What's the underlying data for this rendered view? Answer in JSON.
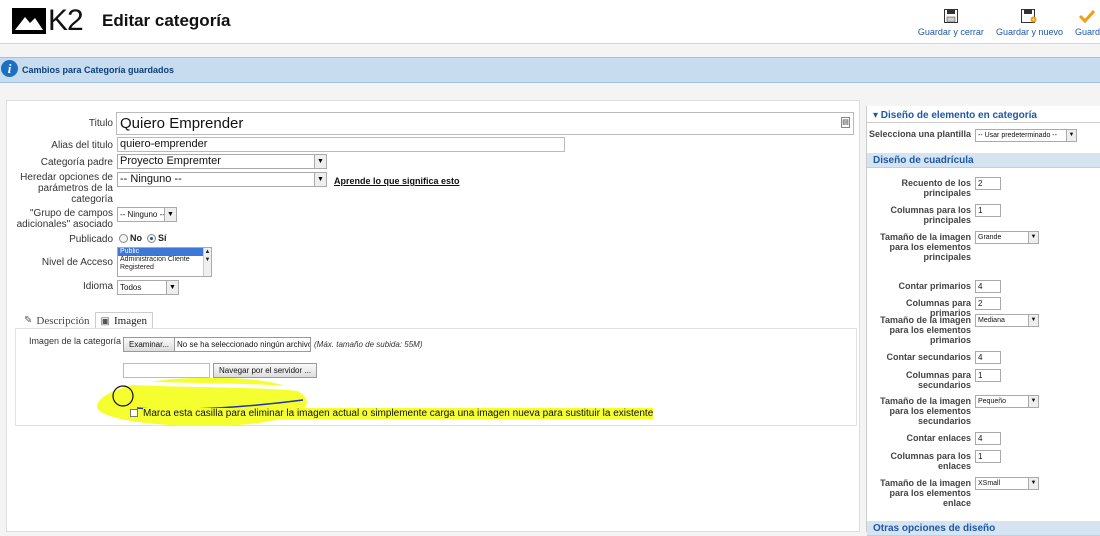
{
  "header": {
    "logo_text": "K2",
    "title": "Editar categoría",
    "buttons": [
      {
        "label": "Guardar y cerrar",
        "icon": "save-icon"
      },
      {
        "label": "Guardar y nuevo",
        "icon": "save-new-icon"
      },
      {
        "label": "Guard",
        "icon": "checkmark-icon"
      }
    ]
  },
  "message": "Cambios para Categoría guardados",
  "form": {
    "title_label": "Titulo",
    "title_value": "Quiero Emprender",
    "alias_label": "Alias del titulo",
    "alias_value": "quiero-emprender",
    "parent_label": "Categoría padre",
    "parent_value": "Proyecto Empremter",
    "inherit_label": "Heredar opciones de parámetros de la categoría",
    "inherit_value": "-- Ninguno --",
    "inherit_link": "Aprende lo que significa esto",
    "extra_fields_label": "\"Grupo de campos adicionales\" asociado",
    "extra_fields_value": "-- Ninguno --",
    "published_label": "Publicado",
    "published_no": "No",
    "published_yes": "Sí",
    "access_label": "Nivel de Acceso",
    "access_options": [
      "Public",
      "Administracion Cliente",
      "Registered"
    ],
    "language_label": "Idioma",
    "language_value": "Todos"
  },
  "tabs": [
    {
      "label": "Descripción",
      "icon": "edit-icon",
      "active": false
    },
    {
      "label": "Imagen",
      "icon": "image-icon",
      "active": true
    }
  ],
  "image_tab": {
    "image_label": "Imagen de la categoría",
    "browse_button": "Examinar...",
    "no_file": "No se ha seleccionado ningún archivo.",
    "max_size": "(Máx. tamaño de subida: 55M)",
    "server_button": "Navegar por el servidor ...",
    "delete_note": "Marca esta casilla para eliminar la imagen actual o simplemente carga una imagen nueva para sustituir la existente"
  },
  "sidebar": {
    "section_head": "▾ Diseño de elemento en categoría",
    "template_label": "Selecciona una plantilla",
    "template_value": "-- Usar predeterminado --",
    "grid_head": "Diseño de cuadrícula",
    "fields": [
      {
        "label": "Recuento de los principales",
        "value": "2",
        "type": "input"
      },
      {
        "label": "Columnas para los principales",
        "value": "1",
        "type": "input"
      },
      {
        "label": "Tamaño de la imagen para los elementos principales",
        "value": "Grande",
        "type": "select"
      },
      {
        "label": "Contar primarios",
        "value": "4",
        "type": "input"
      },
      {
        "label": "Columnas para primarios",
        "value": "2",
        "type": "input"
      },
      {
        "label": "Tamaño de la imagen para los elementos primarios",
        "value": "Mediana",
        "type": "select"
      },
      {
        "label": "Contar secundarios",
        "value": "4",
        "type": "input"
      },
      {
        "label": "Columnas para secundarios",
        "value": "1",
        "type": "input"
      },
      {
        "label": "Tamaño de la imagen para los elementos secundarios",
        "value": "Pequeño",
        "type": "select"
      },
      {
        "label": "Contar enlaces",
        "value": "4",
        "type": "input"
      },
      {
        "label": "Columnas para los enlaces",
        "value": "1",
        "type": "input"
      },
      {
        "label": "Tamaño de la imagen para los elementos enlace",
        "value": "XSmall",
        "type": "select"
      }
    ],
    "other_head": "Otras opciones de diseño"
  }
}
